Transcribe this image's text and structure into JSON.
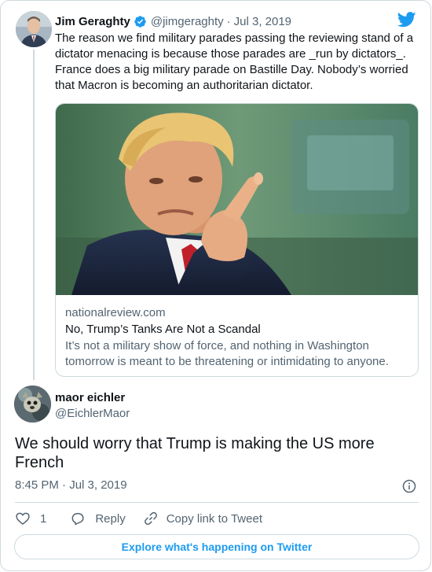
{
  "parent_tweet": {
    "author_name": "Jim Geraghty",
    "handle": "@jimgeraghty",
    "date": "Jul 3, 2019",
    "text_lines": [
      "The reason we find military parades passing the reviewing stand of a",
      "dictator menacing is because those parades are _run by dictators_.",
      "France does a big military parade on Bastille Day. Nobody’s worried",
      "that Macron is becoming an authoritarian dictator."
    ],
    "link_card": {
      "domain": "nationalreview.com",
      "title": "No, Trump’s Tanks Are Not a Scandal",
      "description_lines": [
        "It’s not a military show of force, and nothing in Washington",
        "tomorrow is meant to be threatening or intimidating to anyone."
      ]
    }
  },
  "main_tweet": {
    "author_name": "maor eichler",
    "handle": "@EichlerMaor",
    "text_lines": [
      "We should worry that Trump is making the US more",
      "French"
    ],
    "timestamp": "8:45 PM · Jul 3, 2019"
  },
  "actions": {
    "like_count": "1",
    "reply_label": "Reply",
    "copy_link_label": "Copy link to Tweet"
  },
  "footer": {
    "explore_label": "Explore what's happening on Twitter"
  },
  "colors": {
    "twitter_blue": "#1d9bf0",
    "text_primary": "#0f1419",
    "text_secondary": "#536471",
    "border": "#cfd9de"
  },
  "icons": [
    "twitter-bird-icon",
    "verified-badge-icon",
    "info-icon",
    "heart-icon",
    "reply-icon",
    "link-icon"
  ]
}
